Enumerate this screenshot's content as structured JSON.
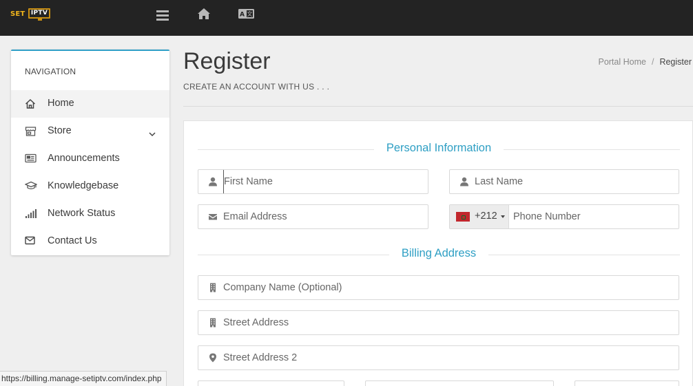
{
  "topbar": {
    "logo_left": "SET",
    "logo_right": "IPTV",
    "brand_color": "#f1b51c",
    "icons": [
      "menu-icon",
      "home-icon",
      "language-icon"
    ]
  },
  "sidebar": {
    "title": "NAVIGATION",
    "accent": "#2f9fc7",
    "items": [
      {
        "label": "Home",
        "icon": "home-icon",
        "active": true
      },
      {
        "label": "Store",
        "icon": "store-icon",
        "has_dropdown": true
      },
      {
        "label": "Announcements",
        "icon": "newspaper-icon"
      },
      {
        "label": "Knowledgebase",
        "icon": "graduation-cap-icon"
      },
      {
        "label": "Network Status",
        "icon": "signal-icon"
      },
      {
        "label": "Contact Us",
        "icon": "envelope-icon"
      }
    ]
  },
  "header": {
    "title": "Register",
    "subtitle": "CREATE AN ACCOUNT WITH US . . .",
    "breadcrumb": [
      "Portal Home",
      "Register"
    ]
  },
  "form": {
    "section_color": "#2e9fc4",
    "personal": {
      "heading": "Personal Information",
      "first_name_placeholder": "First Name",
      "last_name_placeholder": "Last Name",
      "email_placeholder": "Email Address",
      "phone_code": "+212",
      "phone_placeholder": "Phone Number"
    },
    "billing": {
      "heading": "Billing Address",
      "company_placeholder": "Company Name (Optional)",
      "street_placeholder": "Street Address",
      "street2_placeholder": "Street Address 2"
    }
  },
  "statusbar": {
    "url": "https://billing.manage-setiptv.com/index.php"
  }
}
